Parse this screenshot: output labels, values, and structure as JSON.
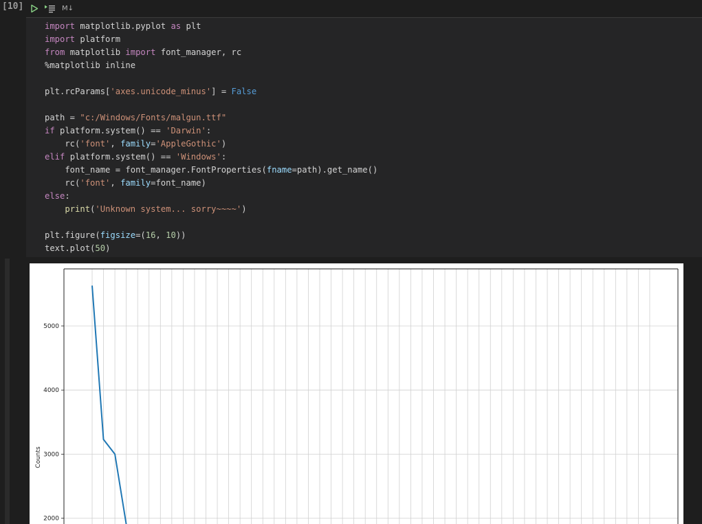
{
  "cell": {
    "execution_count": "[10]",
    "toolbar": {
      "run_icon": "run-icon",
      "run_by_line_icon": "run-by-line-icon",
      "markdown_label": "M↓"
    },
    "code_lines": [
      "import matplotlib.pyplot as plt",
      "import platform",
      "from matplotlib import font_manager, rc",
      "%matplotlib inline",
      "",
      "plt.rcParams['axes.unicode_minus'] = False",
      "",
      "path = \"c:/Windows/Fonts/malgun.ttf\"",
      "if platform.system() == 'Darwin':",
      "    rc('font', family='AppleGothic')",
      "elif platform.system() == 'Windows':",
      "    font_name = font_manager.FontProperties(fname=path).get_name()",
      "    rc('font', family=font_name)",
      "else:",
      "    print('Unknown system... sorry~~~~')",
      "",
      "plt.figure(figsize=(16, 10))",
      "text.plot(50)"
    ]
  },
  "colors": {
    "background": "#1e1e1e",
    "code_background": "#252526",
    "keyword": "#c586c0",
    "string": "#ce9178",
    "boolean": "#569cd6",
    "function": "#dcdcaa",
    "parameter": "#9cdcfe",
    "line_series": "#1f77b4",
    "run_icon": "#89d185"
  },
  "chart_data": {
    "type": "line",
    "ylabel": "Counts",
    "yticks": [
      5000,
      4000,
      3000,
      2000
    ],
    "ylim_visible": [
      1910,
      5920
    ],
    "x_count": 50,
    "grid": true,
    "series": [
      {
        "values": [
          5630,
          3230,
          3000,
          1900
        ]
      }
    ]
  }
}
